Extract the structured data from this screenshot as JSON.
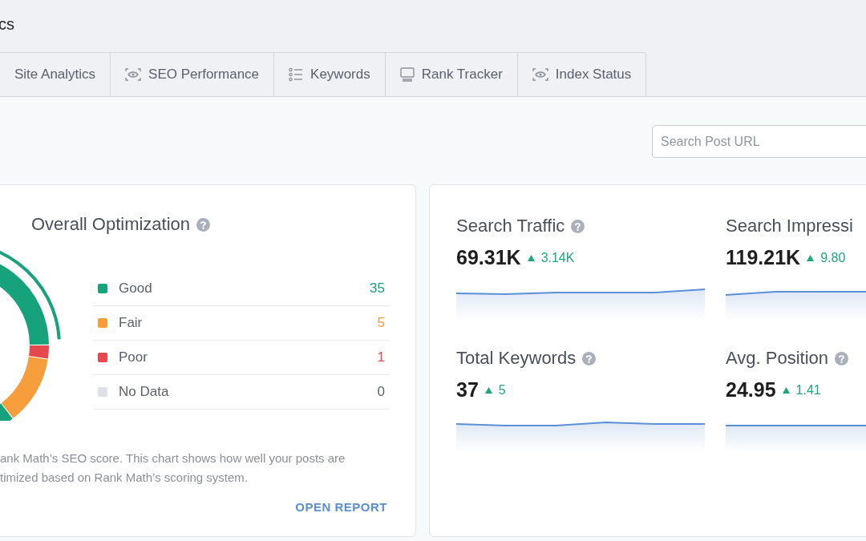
{
  "page_title": "cs",
  "tabs": [
    {
      "label": "Site Analytics",
      "selected": false
    },
    {
      "label": "SEO Performance",
      "selected": false
    },
    {
      "label": "Keywords",
      "selected": false
    },
    {
      "label": "Rank Tracker",
      "selected": false
    },
    {
      "label": "Index Status",
      "selected": false
    }
  ],
  "search": {
    "placeholder": "Search Post URL"
  },
  "optimization": {
    "title": "Overall Optimization",
    "legend": [
      {
        "label": "Good",
        "value": "35",
        "color": "#16a37b"
      },
      {
        "label": "Fair",
        "value": "5",
        "color": "#f59e3b"
      },
      {
        "label": "Poor",
        "value": "1",
        "color": "#e5484d"
      },
      {
        "label": "No Data",
        "value": "0",
        "color": "#dde1e5"
      }
    ],
    "description_lines": [
      "ank Math’s SEO score. This chart shows how well your posts are",
      "timized based on Rank Math’s scoring system."
    ],
    "link": "OPEN REPORT"
  },
  "metrics": [
    {
      "title": "Search Traffic",
      "value": "69.31K",
      "delta": "3.14K"
    },
    {
      "title": "Search Impressi",
      "value": "119.21K",
      "delta": "9.80"
    },
    {
      "title": "Total Keywords",
      "value": "37",
      "delta": "5"
    },
    {
      "title": "Avg. Position",
      "value": "24.95",
      "delta": "1.41"
    }
  ]
}
